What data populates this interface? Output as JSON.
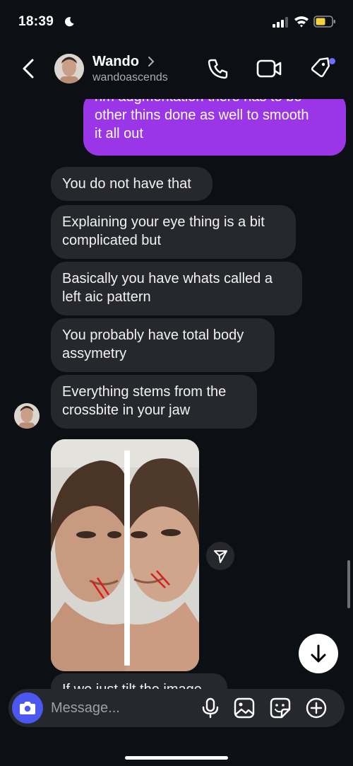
{
  "status_bar": {
    "time": "18:39",
    "battery_color": "#f2d33b"
  },
  "header": {
    "name": "Wando",
    "handle": "wandoascends",
    "icons": [
      "back-icon",
      "chevron-right-icon",
      "phone-icon",
      "video-camera-icon",
      "tag-icon"
    ]
  },
  "messages": {
    "outgoing_partial": [
      "rim augmentation there has to be",
      "other thins done as well to smooth",
      "it all out"
    ],
    "incoming": [
      [
        "You do not have that"
      ],
      [
        "Explaining your eye thing is a bit",
        "complicated but"
      ],
      [
        "Basically you have whats called a",
        "left aic pattern"
      ],
      [
        "You probably have total body",
        "assymetry"
      ],
      [
        "Everything stems from the",
        "crossbite in your jaw"
      ]
    ],
    "next_partial": "If we just tilt the image"
  },
  "composer": {
    "placeholder": "Message..."
  },
  "colors": {
    "outgoing_bubble": "#9b35e8",
    "incoming_bubble": "#26282d",
    "camera_button": "#4b57f0",
    "background": "#0c0f14"
  }
}
